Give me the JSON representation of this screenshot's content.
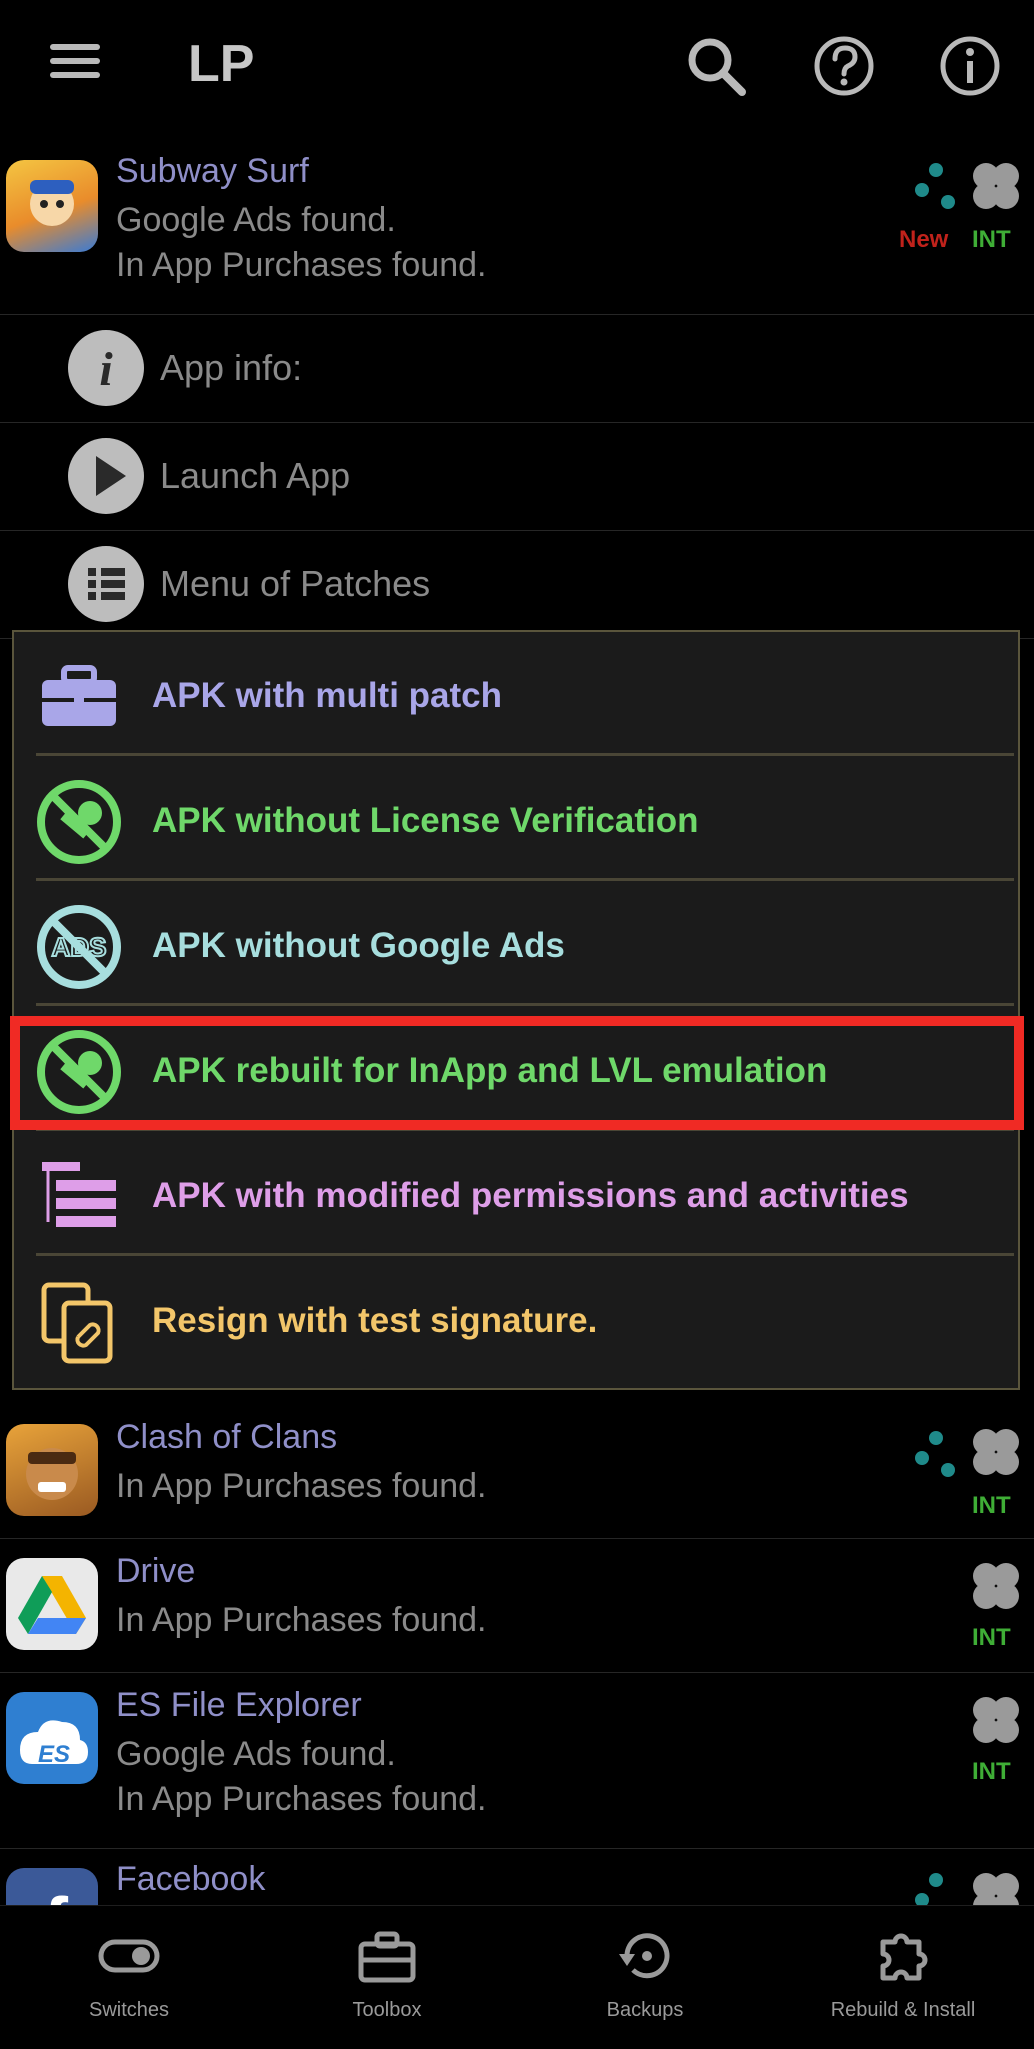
{
  "appbar": {
    "title": "LP",
    "icons": [
      "menu-icon",
      "search-icon",
      "help-icon",
      "info-icon"
    ]
  },
  "apps": [
    {
      "name": "Subway Surf",
      "lines": [
        "Google Ads found.",
        "In App Purchases found."
      ],
      "badges": [
        "New",
        "INT"
      ]
    },
    {
      "name": "Clash of Clans",
      "lines": [
        "In App Purchases found."
      ],
      "badges": [
        "INT"
      ]
    },
    {
      "name": "Drive",
      "lines": [
        "In App Purchases found."
      ],
      "badges": [
        "INT"
      ]
    },
    {
      "name": "ES File Explorer",
      "lines": [
        "Google Ads found.",
        "In App Purchases found."
      ],
      "badges": [
        "INT"
      ]
    },
    {
      "name": "Facebook",
      "lines": [],
      "badges": []
    }
  ],
  "submenu": [
    {
      "label": "App info:",
      "icon": "info-icon"
    },
    {
      "label": "Launch App",
      "icon": "play-icon"
    },
    {
      "label": "Menu of Patches",
      "icon": "list-icon"
    }
  ],
  "patch_menu": [
    {
      "label": "APK with multi patch",
      "color": "#a9a6e8",
      "icon": "toolbox-icon"
    },
    {
      "label": "APK without License Verification",
      "color": "#6fd86a",
      "icon": "no-key-icon"
    },
    {
      "label": "APK without Google Ads",
      "color": "#a7dede",
      "icon": "no-ads-icon"
    },
    {
      "label": "APK rebuilt for InApp and LVL emulation",
      "color": "#6fd86a",
      "icon": "no-key-icon",
      "highlighted": true
    },
    {
      "label": "APK with modified permissions and activities",
      "color": "#de9ee8",
      "icon": "permissions-list-icon"
    },
    {
      "label": "Resign with test signature.",
      "color": "#f3c66a",
      "icon": "signature-file-icon"
    }
  ],
  "colors": {
    "badge_new": "#c0221b",
    "badge_int": "#3fae36",
    "highlight_border": "#f02a24"
  },
  "bottom_nav": [
    {
      "label": "Switches",
      "icon": "toggle-icon"
    },
    {
      "label": "Toolbox",
      "icon": "toolbox-icon"
    },
    {
      "label": "Backups",
      "icon": "restore-icon"
    },
    {
      "label": "Rebuild & Install",
      "icon": "puzzle-icon"
    }
  ]
}
